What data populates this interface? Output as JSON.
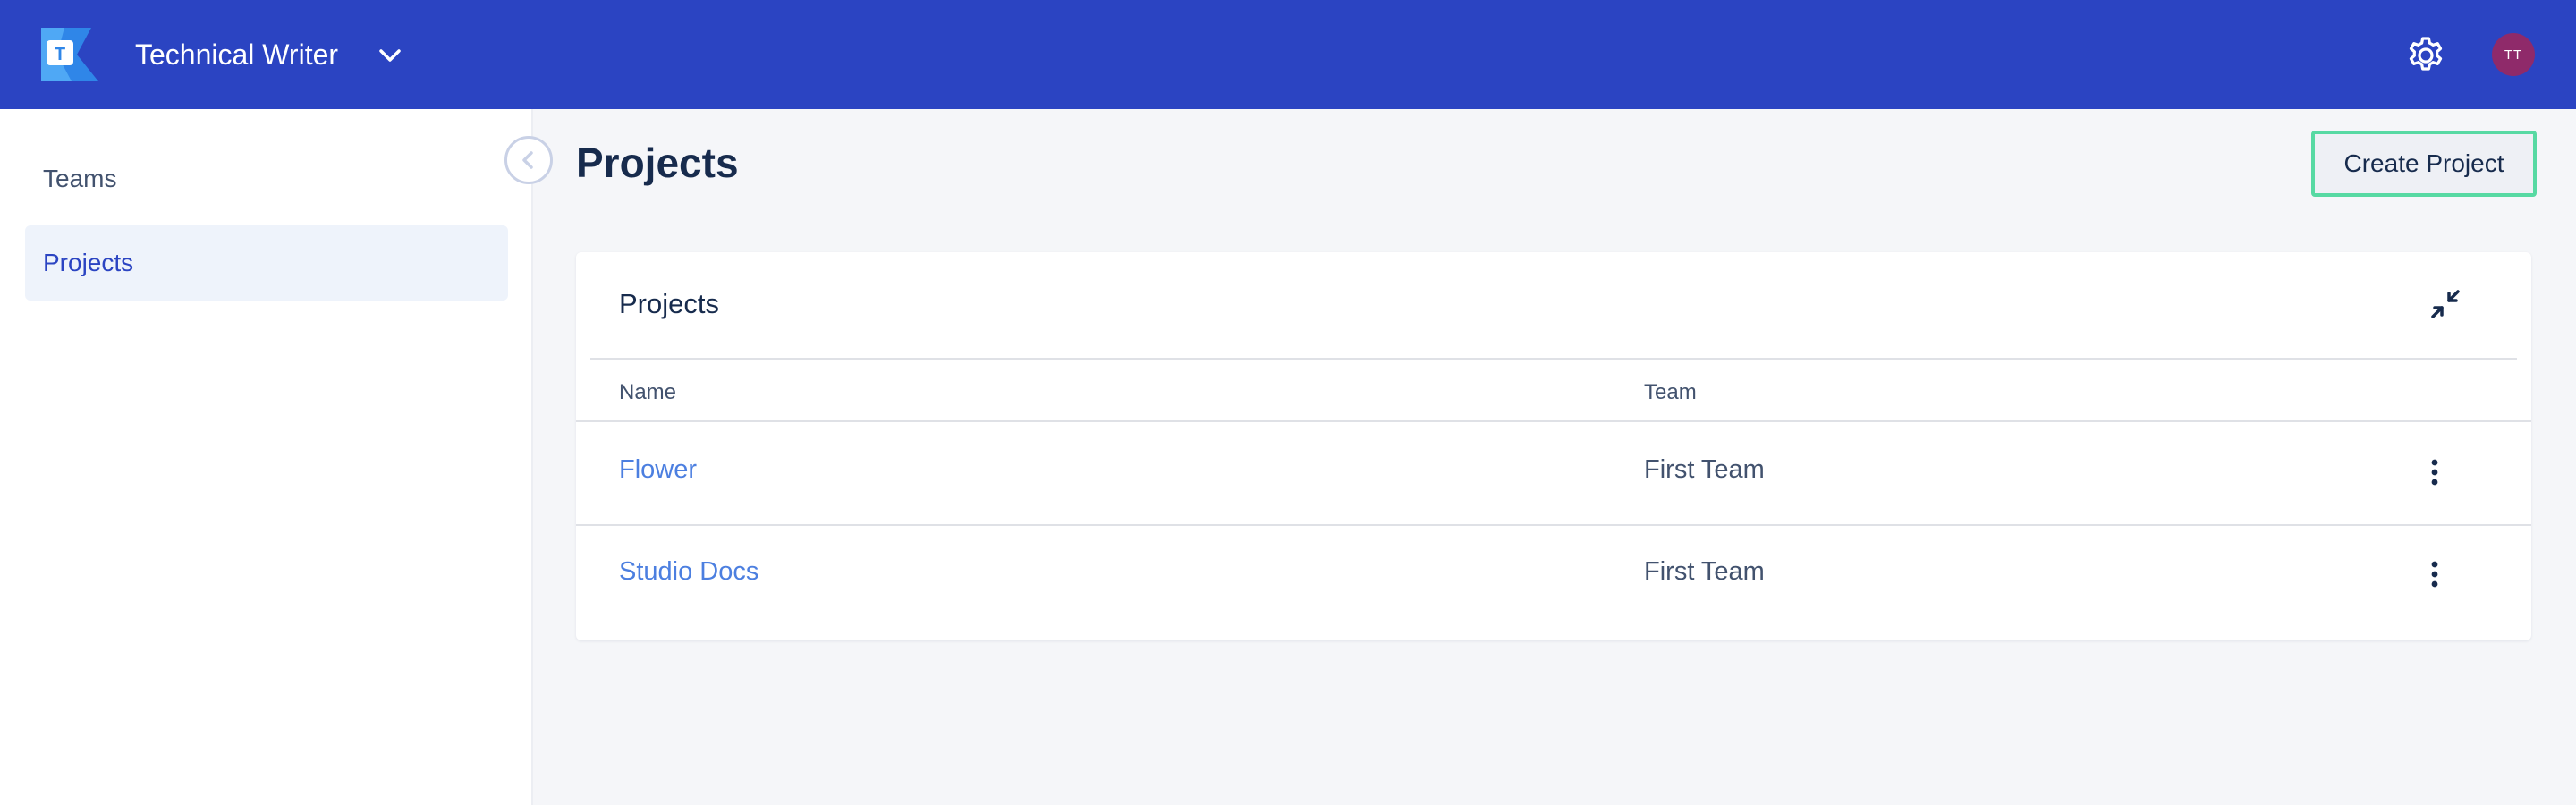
{
  "header": {
    "workspace_name": "Technical Writer",
    "logo_letter": "T",
    "avatar_initials": "TT",
    "logo_icon": "workspace-logo",
    "chevron_icon": "chevron-down-icon",
    "settings_icon": "gear-icon"
  },
  "sidebar": {
    "items": [
      {
        "label": "Teams",
        "active": false
      },
      {
        "label": "Projects",
        "active": true
      }
    ],
    "collapse_icon": "chevron-left-icon"
  },
  "main": {
    "title": "Projects",
    "create_button_label": "Create Project"
  },
  "projects_card": {
    "title": "Projects",
    "minimize_icon": "minimize-icon",
    "columns": [
      "Name",
      "Team"
    ],
    "rows": [
      {
        "name": "Flower",
        "team": "First Team"
      },
      {
        "name": "Studio Docs",
        "team": "First Team"
      }
    ],
    "row_menu_icon": "more-vertical-icon"
  },
  "colors": {
    "topbar": "#2b44c2",
    "link": "#4c7fe0",
    "create_button_border": "#57d9a3",
    "avatar": "#8f2a6a"
  }
}
